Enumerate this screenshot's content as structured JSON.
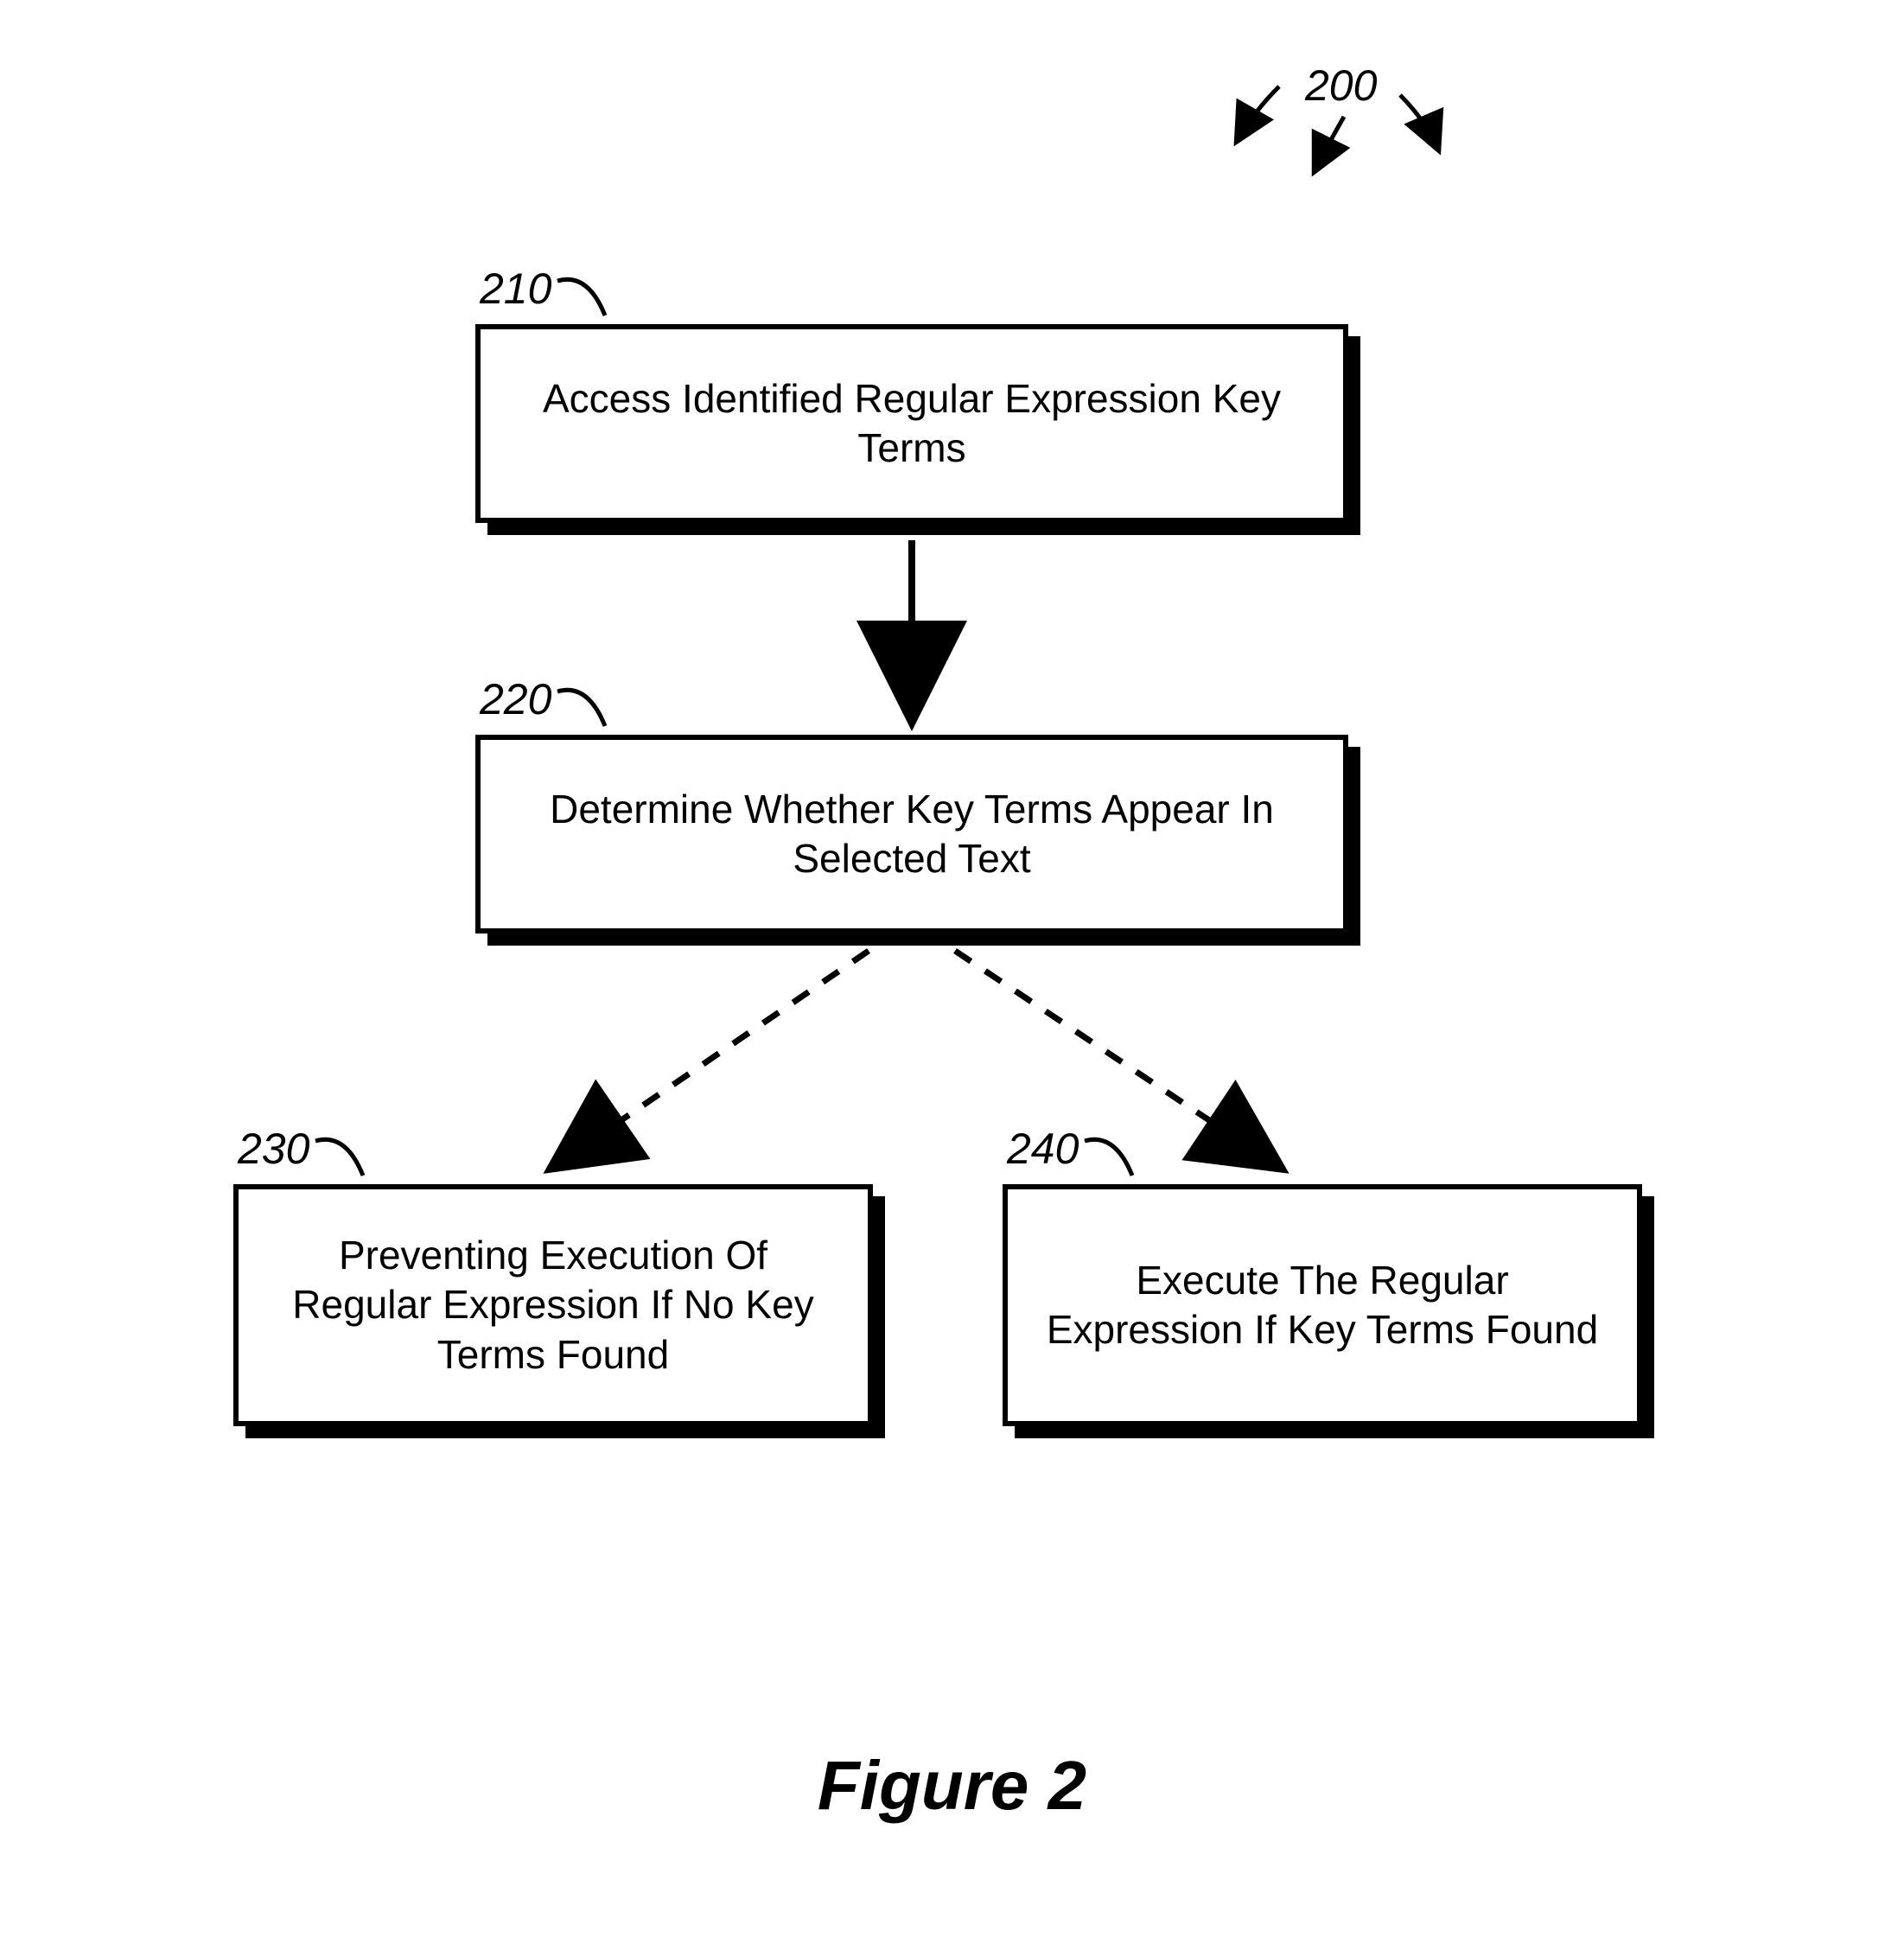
{
  "diagram": {
    "ref_title": "200",
    "figure_caption": "Figure 2",
    "boxes": {
      "b210": {
        "ref": "210",
        "text": "Access Identified Regular Expression Key Terms"
      },
      "b220": {
        "ref": "220",
        "text": "Determine Whether Key Terms Appear In Selected Text"
      },
      "b230": {
        "ref": "230",
        "text": "Preventing Execution Of Regular Expression If No Key Terms Found"
      },
      "b240": {
        "ref": "240",
        "text": "Execute The Regular Expression If Key Terms Found"
      }
    }
  },
  "chart_data": {
    "type": "flowchart",
    "title": "Figure 2",
    "reference_numeral": "200",
    "nodes": [
      {
        "id": "210",
        "label": "Access Identified Regular Expression Key Terms"
      },
      {
        "id": "220",
        "label": "Determine Whether Key Terms Appear In Selected Text"
      },
      {
        "id": "230",
        "label": "Preventing Execution Of Regular Expression If No Key Terms Found"
      },
      {
        "id": "240",
        "label": "Execute The Regular Expression If Key Terms Found"
      }
    ],
    "edges": [
      {
        "from": "210",
        "to": "220",
        "style": "solid"
      },
      {
        "from": "220",
        "to": "230",
        "style": "dashed"
      },
      {
        "from": "220",
        "to": "240",
        "style": "dashed"
      }
    ]
  }
}
